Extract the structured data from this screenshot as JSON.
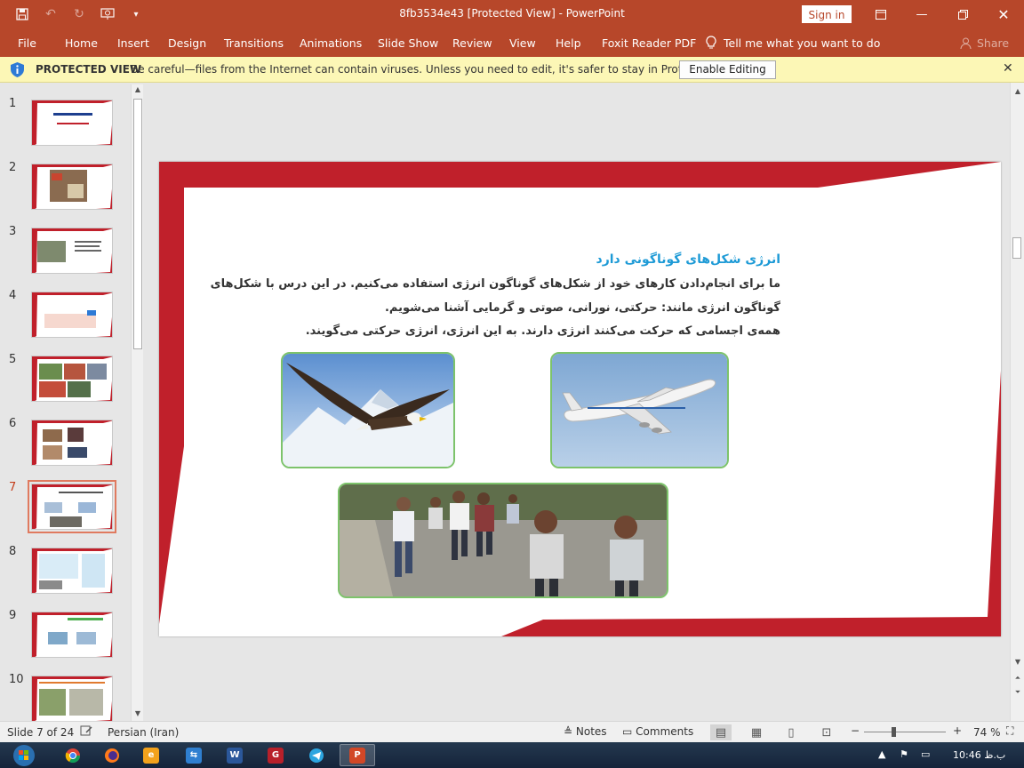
{
  "window": {
    "title": "8fb3534e43 [Protected View]  -  PowerPoint",
    "signin_label": "Sign in"
  },
  "ribbon": {
    "tabs": [
      "File",
      "Home",
      "Insert",
      "Design",
      "Transitions",
      "Animations",
      "Slide Show",
      "Review",
      "View",
      "Help",
      "Foxit Reader PDF"
    ],
    "tellme": "Tell me what you want to do",
    "share": "Share"
  },
  "protected_view": {
    "title": "PROTECTED VIEW",
    "message": "Be careful—files from the Internet can contain viruses. Unless you need to edit, it's safer to stay in Protected View.",
    "enable_label": "Enable Editing"
  },
  "thumbnails": {
    "numbers": [
      "1",
      "2",
      "3",
      "4",
      "5",
      "6",
      "7",
      "8",
      "9",
      "10"
    ],
    "selected": "7"
  },
  "slide": {
    "title": "انرژی شکل‌های گوناگونی دارد",
    "line1": "ما برای انجام‌دادن کارهای خود از شکل‌های گوناگون انرژی استفاده می‌کنیم. در این درس با شکل‌های",
    "line2": "گوناگون انرژی مانند: حرکتی، نورانی، صوتی و گرمایی آشنا می‌شویم.",
    "line3": "همه‌ی اجسامی که حرکت می‌کنند انرژی دارند. به این انرژی، انرژی حرکتی می‌گویند.",
    "frame_color": "#c0202b",
    "title_color": "#1d9ad6"
  },
  "status": {
    "slide_info": "Slide 7 of 24",
    "language": "Persian (Iran)",
    "notes_label": "Notes",
    "comments_label": "Comments",
    "zoom": "74 %"
  },
  "taskbar": {
    "clock": "10:46 ب.ظ"
  }
}
